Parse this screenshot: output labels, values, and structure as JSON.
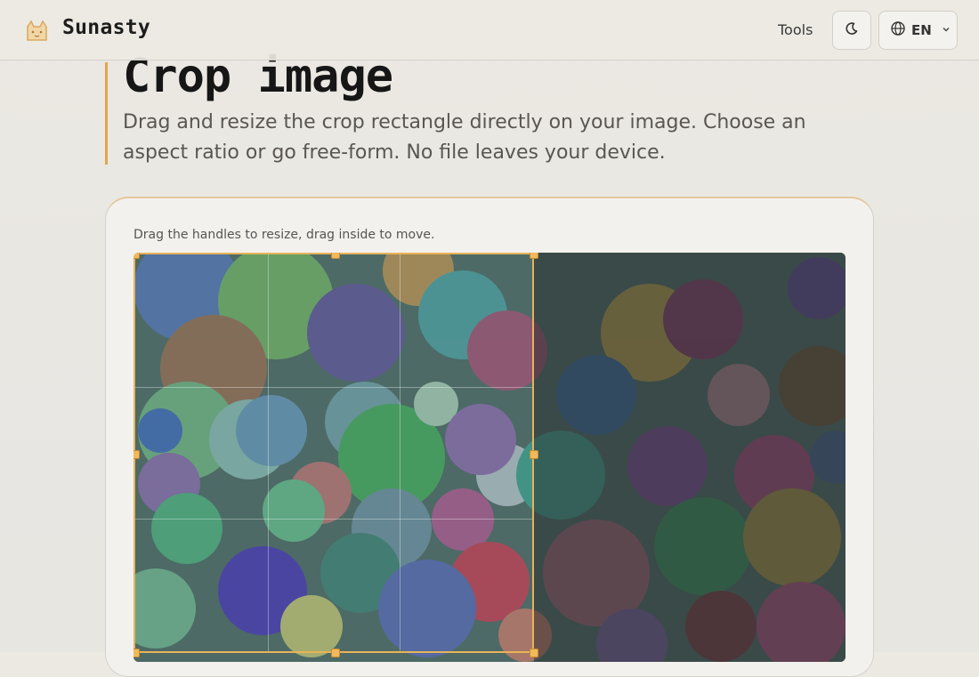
{
  "header": {
    "brand": "Sunasty",
    "tools_label": "Tools",
    "language_label": "EN",
    "icons": {
      "logo": "cat-logo-icon",
      "theme": "moon-icon",
      "language": "globe-icon",
      "dropdown": "chevron-down-icon"
    }
  },
  "page": {
    "title": "Crop image",
    "description": "Drag and resize the crop rectangle directly on your image. Choose an aspect ratio or go free-form. No file leaves your device."
  },
  "cropper": {
    "hint": "Drag the handles to resize, drag inside to move."
  },
  "colors": {
    "accent": "#e3a54f",
    "crop_border": "#e8b358"
  }
}
